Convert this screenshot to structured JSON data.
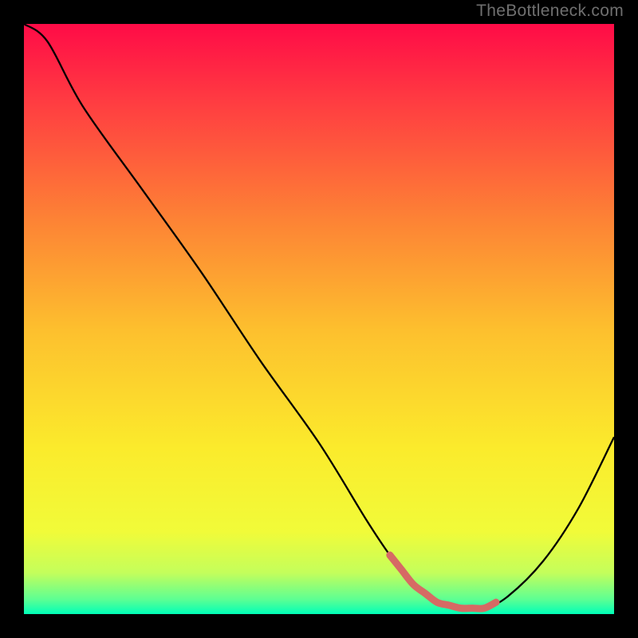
{
  "watermark": "TheBottleneck.com",
  "chart_data": {
    "type": "line",
    "title": "",
    "xlabel": "",
    "ylabel": "",
    "xlim": [
      0,
      100
    ],
    "ylim": [
      0,
      100
    ],
    "series": [
      {
        "name": "curve",
        "x": [
          0,
          4,
          10,
          20,
          30,
          40,
          50,
          58,
          62,
          66,
          70,
          74,
          78,
          82,
          88,
          94,
          100
        ],
        "values": [
          100,
          97,
          86,
          72,
          58,
          43,
          29,
          16,
          10,
          5,
          2,
          1,
          1,
          3,
          9,
          18,
          30
        ]
      }
    ],
    "annotations": {
      "highlight_segment": {
        "x_start": 62,
        "x_end": 80,
        "color": "#d66a64"
      }
    },
    "background": {
      "type": "vertical_gradient",
      "stops": [
        {
          "pos": 0.0,
          "color": "#ff0b47"
        },
        {
          "pos": 0.14,
          "color": "#ff3f41"
        },
        {
          "pos": 0.33,
          "color": "#fd8235"
        },
        {
          "pos": 0.52,
          "color": "#fdc02e"
        },
        {
          "pos": 0.72,
          "color": "#fbeb2c"
        },
        {
          "pos": 0.86,
          "color": "#f1fb39"
        },
        {
          "pos": 0.93,
          "color": "#c4fe5b"
        },
        {
          "pos": 0.975,
          "color": "#5dff93"
        },
        {
          "pos": 1.0,
          "color": "#00ffb8"
        }
      ]
    }
  }
}
